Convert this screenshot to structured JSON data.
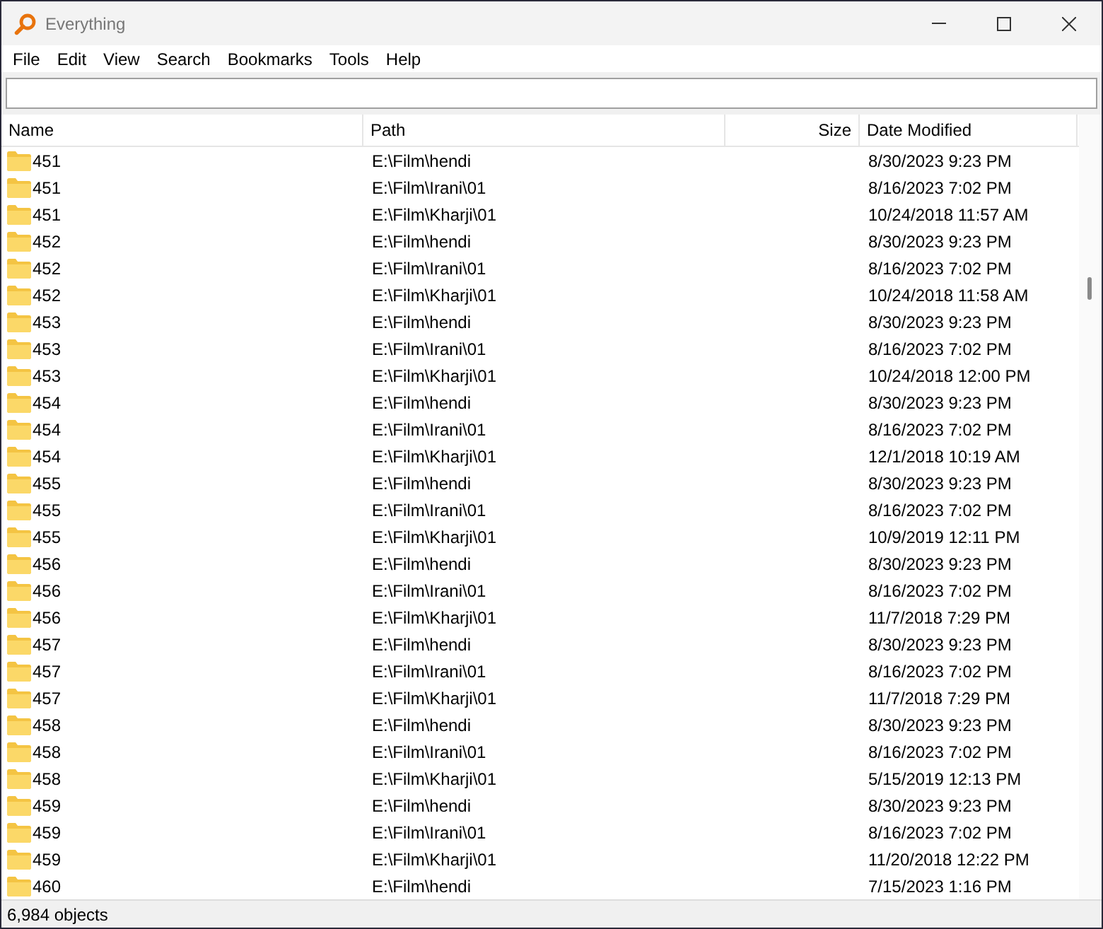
{
  "window": {
    "title": "Everything"
  },
  "menu": [
    "File",
    "Edit",
    "View",
    "Search",
    "Bookmarks",
    "Tools",
    "Help"
  ],
  "table": {
    "columns": [
      "Name",
      "Path",
      "Size",
      "Date Modified"
    ],
    "rows": [
      {
        "name": "451",
        "path": "E:\\Film\\hendi",
        "date": "8/30/2023 9:23 PM"
      },
      {
        "name": "451",
        "path": "E:\\Film\\Irani\\01",
        "date": "8/16/2023 7:02 PM"
      },
      {
        "name": "451",
        "path": "E:\\Film\\Kharji\\01",
        "date": "10/24/2018 11:57 AM"
      },
      {
        "name": "452",
        "path": "E:\\Film\\hendi",
        "date": "8/30/2023 9:23 PM"
      },
      {
        "name": "452",
        "path": "E:\\Film\\Irani\\01",
        "date": "8/16/2023 7:02 PM"
      },
      {
        "name": "452",
        "path": "E:\\Film\\Kharji\\01",
        "date": "10/24/2018 11:58 AM"
      },
      {
        "name": "453",
        "path": "E:\\Film\\hendi",
        "date": "8/30/2023 9:23 PM"
      },
      {
        "name": "453",
        "path": "E:\\Film\\Irani\\01",
        "date": "8/16/2023 7:02 PM"
      },
      {
        "name": "453",
        "path": "E:\\Film\\Kharji\\01",
        "date": "10/24/2018 12:00 PM"
      },
      {
        "name": "454",
        "path": "E:\\Film\\hendi",
        "date": "8/30/2023 9:23 PM"
      },
      {
        "name": "454",
        "path": "E:\\Film\\Irani\\01",
        "date": "8/16/2023 7:02 PM"
      },
      {
        "name": "454",
        "path": "E:\\Film\\Kharji\\01",
        "date": "12/1/2018 10:19 AM"
      },
      {
        "name": "455",
        "path": "E:\\Film\\hendi",
        "date": "8/30/2023 9:23 PM"
      },
      {
        "name": "455",
        "path": "E:\\Film\\Irani\\01",
        "date": "8/16/2023 7:02 PM"
      },
      {
        "name": "455",
        "path": "E:\\Film\\Kharji\\01",
        "date": "10/9/2019 12:11 PM"
      },
      {
        "name": "456",
        "path": "E:\\Film\\hendi",
        "date": "8/30/2023 9:23 PM"
      },
      {
        "name": "456",
        "path": "E:\\Film\\Irani\\01",
        "date": "8/16/2023 7:02 PM"
      },
      {
        "name": "456",
        "path": "E:\\Film\\Kharji\\01",
        "date": "11/7/2018 7:29 PM"
      },
      {
        "name": "457",
        "path": "E:\\Film\\hendi",
        "date": "8/30/2023 9:23 PM"
      },
      {
        "name": "457",
        "path": "E:\\Film\\Irani\\01",
        "date": "8/16/2023 7:02 PM"
      },
      {
        "name": "457",
        "path": "E:\\Film\\Kharji\\01",
        "date": "11/7/2018 7:29 PM"
      },
      {
        "name": "458",
        "path": "E:\\Film\\hendi",
        "date": "8/30/2023 9:23 PM"
      },
      {
        "name": "458",
        "path": "E:\\Film\\Irani\\01",
        "date": "8/16/2023 7:02 PM"
      },
      {
        "name": "458",
        "path": "E:\\Film\\Kharji\\01",
        "date": "5/15/2019 12:13 PM"
      },
      {
        "name": "459",
        "path": "E:\\Film\\hendi",
        "date": "8/30/2023 9:23 PM"
      },
      {
        "name": "459",
        "path": "E:\\Film\\Irani\\01",
        "date": "8/16/2023 7:02 PM"
      },
      {
        "name": "459",
        "path": "E:\\Film\\Kharji\\01",
        "date": "11/20/2018 12:22 PM"
      },
      {
        "name": "460",
        "path": "E:\\Film\\hendi",
        "date": "7/15/2023 1:16 PM"
      }
    ]
  },
  "status_bar": "6,984 objects"
}
